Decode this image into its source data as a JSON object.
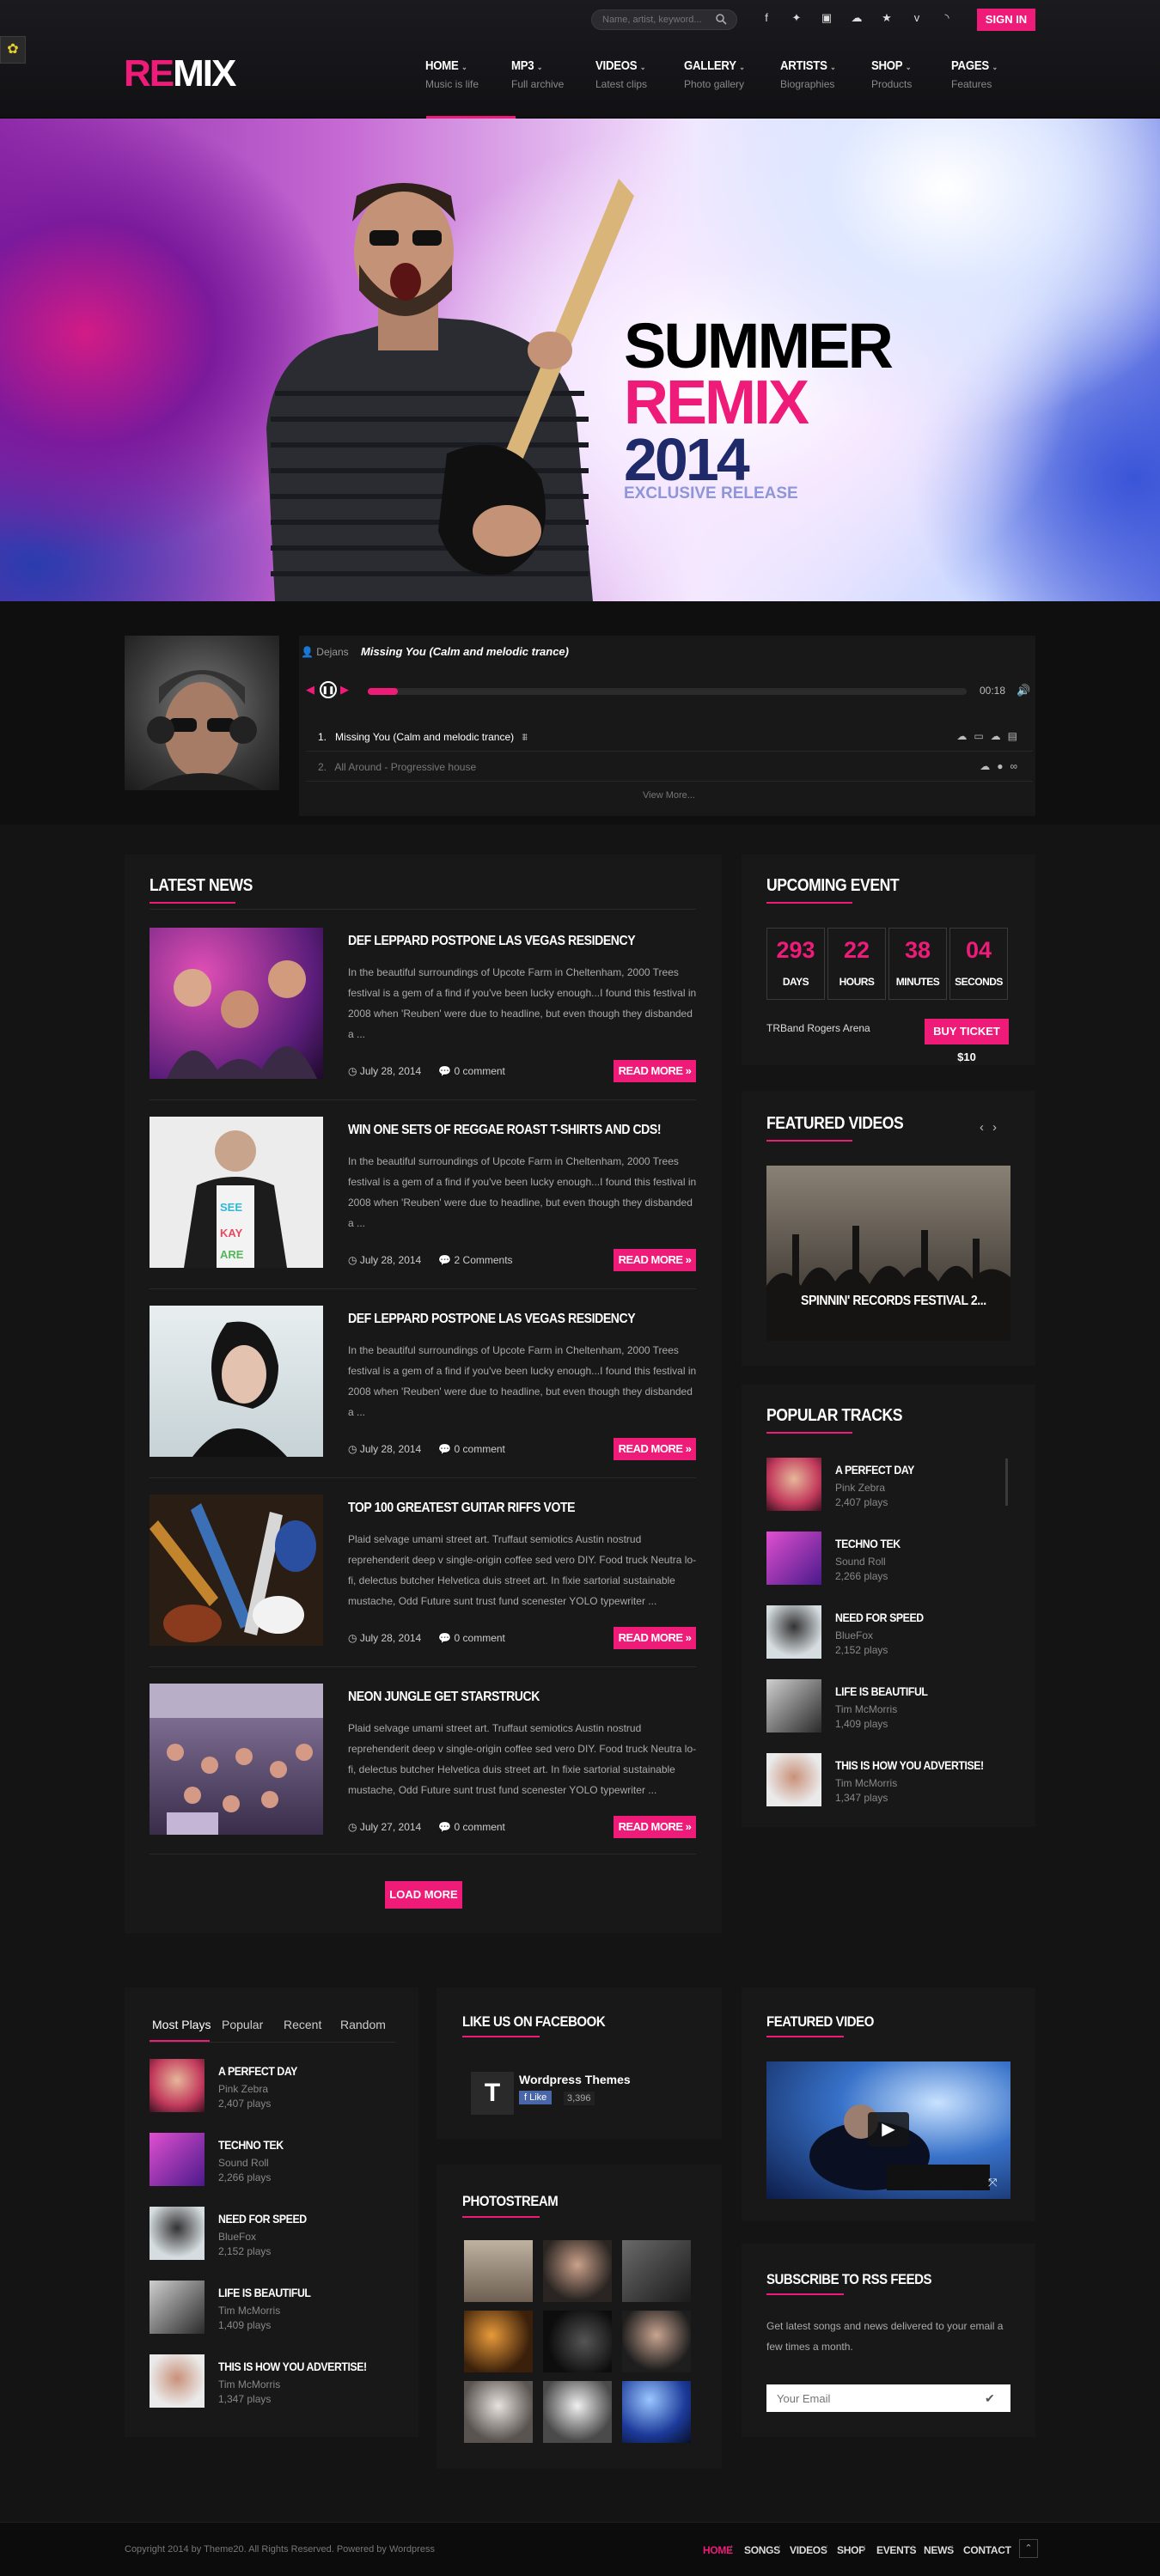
{
  "header": {
    "search_placeholder": "Name, artist, keyword...",
    "signin_label": "SIGN IN",
    "logo_re": "RE",
    "logo_mix": "MIX",
    "social_icons": [
      "facebook-icon",
      "twitter-icon",
      "instagram-icon",
      "soundcloud-icon",
      "star-icon",
      "vimeo-icon",
      "rss-icon"
    ],
    "nav": [
      {
        "title": "HOME",
        "sub": "Music is life"
      },
      {
        "title": "MP3",
        "sub": "Full archive"
      },
      {
        "title": "VIDEOS",
        "sub": "Latest clips"
      },
      {
        "title": "GALLERY",
        "sub": "Photo gallery"
      },
      {
        "title": "ARTISTS",
        "sub": "Biographies"
      },
      {
        "title": "SHOP",
        "sub": "Products"
      },
      {
        "title": "PAGES",
        "sub": "Features"
      }
    ]
  },
  "hero": {
    "line1": "SUMMER",
    "line2": "REMIX",
    "line3": "2014",
    "line4": "EXCLUSIVE RELEASE"
  },
  "player": {
    "artist": "Dejans",
    "title": "Missing You (Calm and melodic trance)",
    "time": "00:18",
    "progress": 0.05,
    "tracks": [
      {
        "num": "1.",
        "name": "Missing You (Calm and melodic trance)"
      },
      {
        "num": "2.",
        "name": "All Around - Progressive house"
      }
    ],
    "view_more": "View More..."
  },
  "latest_news": {
    "title": "LATEST NEWS",
    "items": [
      {
        "title": "DEF LEPPARD POSTPONE LAS VEGAS RESIDENCY",
        "text": "In the beautiful surroundings of Upcote Farm in Cheltenham, 2000 Trees festival is a gem of a find if you've been lucky enough...I found this festival in 2008 when 'Reuben' were due to headline, but even though they disbanded a ...",
        "date": "July 28, 2014",
        "comments": "0 comment",
        "read_more": "READ MORE »"
      },
      {
        "title": "WIN ONE SETS OF REGGAE ROAST T-SHIRTS AND CDS!",
        "text": "In the beautiful surroundings of Upcote Farm in Cheltenham, 2000 Trees festival is a gem of a find if you've been lucky enough...I found this festival in 2008 when 'Reuben' were due to headline, but even though they disbanded a ...",
        "date": "July 28, 2014",
        "comments": "2 Comments",
        "read_more": "READ MORE »"
      },
      {
        "title": "DEF LEPPARD POSTPONE LAS VEGAS RESIDENCY",
        "text": "In the beautiful surroundings of Upcote Farm in Cheltenham, 2000 Trees festival is a gem of a find if you've been lucky enough...I found this festival in 2008 when 'Reuben' were due to headline, but even though they disbanded a ...",
        "date": "July 28, 2014",
        "comments": "0 comment",
        "read_more": "READ MORE »"
      },
      {
        "title": "TOP 100 GREATEST GUITAR RIFFS VOTE",
        "text": "Plaid selvage umami street art. Truffaut semiotics Austin nostrud reprehenderit deep v single-origin coffee sed vero DIY. Food truck Neutra lo-fi, delectus butcher Helvetica duis street art. In fixie sartorial sustainable mustache, Odd Future sunt trust fund scenester YOLO typewriter ...",
        "date": "July 28, 2014",
        "comments": "0 comment",
        "read_more": "READ MORE »"
      },
      {
        "title": "NEON JUNGLE GET STARSTRUCK",
        "text": "Plaid selvage umami street art. Truffaut semiotics Austin nostrud reprehenderit deep v single-origin coffee sed vero DIY. Food truck Neutra lo-fi, delectus butcher Helvetica duis street art. In fixie sartorial sustainable mustache, Odd Future sunt trust fund scenester YOLO typewriter ...",
        "date": "July 27, 2014",
        "comments": "0 comment",
        "read_more": "READ MORE »"
      }
    ],
    "load_more": "LOAD MORE"
  },
  "upcoming_event": {
    "title": "UPCOMING EVENT",
    "countdown": [
      {
        "value": "293",
        "label": "DAYS"
      },
      {
        "value": "22",
        "label": "HOURS"
      },
      {
        "value": "38",
        "label": "MINUTES"
      },
      {
        "value": "04",
        "label": "SECONDS"
      }
    ],
    "venue": "TRBand Rogers Arena",
    "buy_label": "BUY TICKET $10"
  },
  "featured_videos": {
    "title": "FEATURED VIDEOS",
    "caption": "SPINNIN' RECORDS FESTIVAL 2..."
  },
  "popular_tracks": {
    "title": "POPULAR TRACKS",
    "items": [
      {
        "name": "A PERFECT DAY",
        "artist": "Pink Zebra",
        "plays": "2,407 plays"
      },
      {
        "name": "TECHNO TEK",
        "artist": "Sound Roll",
        "plays": "2,266 plays"
      },
      {
        "name": "NEED FOR SPEED",
        "artist": "BlueFox",
        "plays": "2,152 plays"
      },
      {
        "name": "LIFE IS BEAUTIFUL",
        "artist": "Tim McMorris",
        "plays": "1,409 plays"
      },
      {
        "name": "THIS IS HOW YOU ADVERTISE!",
        "artist": "Tim McMorris",
        "plays": "1,347 plays"
      }
    ]
  },
  "plays_widget": {
    "tabs": [
      "Most Plays",
      "Popular",
      "Recent",
      "Random"
    ],
    "items": [
      {
        "name": "A PERFECT DAY",
        "artist": "Pink Zebra",
        "plays": "2,407 plays"
      },
      {
        "name": "TECHNO TEK",
        "artist": "Sound Roll",
        "plays": "2,266 plays"
      },
      {
        "name": "NEED FOR SPEED",
        "artist": "BlueFox",
        "plays": "2,152 plays"
      },
      {
        "name": "LIFE IS BEAUTIFUL",
        "artist": "Tim McMorris",
        "plays": "1,409 plays"
      },
      {
        "name": "THIS IS HOW YOU ADVERTISE!",
        "artist": "Tim McMorris",
        "plays": "1,347 plays"
      }
    ]
  },
  "facebook": {
    "title": "LIKE US ON FACEBOOK",
    "name": "Wordpress Themes",
    "like": "Like",
    "count": "3,396",
    "logo": "T"
  },
  "photostream": {
    "title": "PHOTOSTREAM"
  },
  "featured_video": {
    "title": "FEATURED VIDEO"
  },
  "rss": {
    "title": "SUBSCRIBE TO RSS FEEDS",
    "text": "Get latest songs and news delivered to your email a few times a month.",
    "placeholder": "Your Email"
  },
  "footer": {
    "copyright": "Copyright 2014 by Theme20. All Rights Reserved. Powered by Wordpress",
    "nav": [
      "HOME",
      "SONGS",
      "VIDEOS",
      "SHOP",
      "EVENTS",
      "NEWS",
      "CONTACT"
    ]
  },
  "colors": {
    "accent": "#ef1b79",
    "background": "#141414",
    "panel": "#181818"
  }
}
